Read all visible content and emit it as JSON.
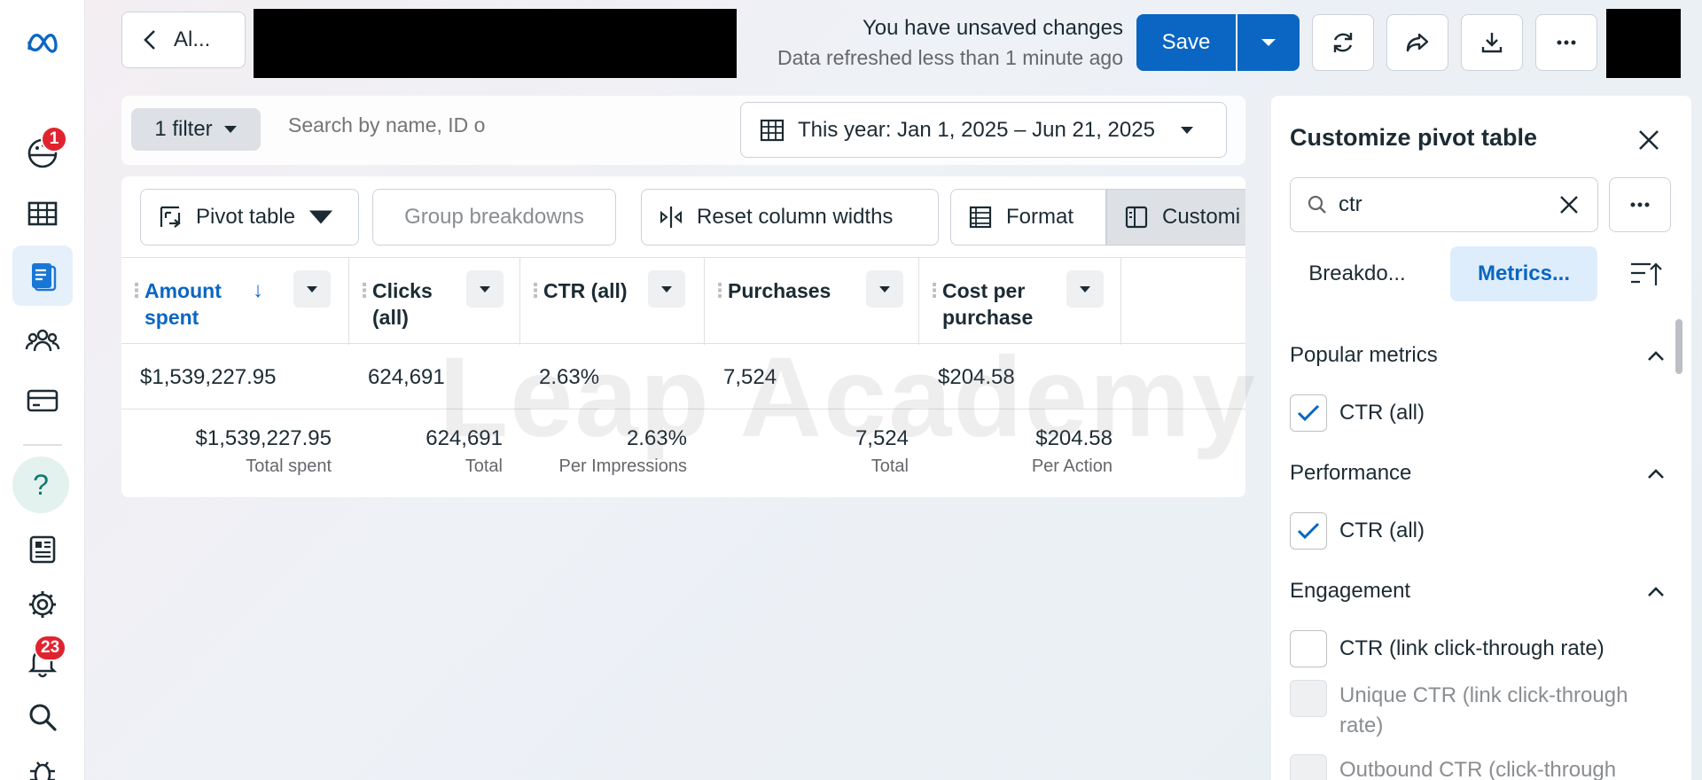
{
  "header": {
    "back_label": "Al...",
    "unsaved_text": "You have unsaved changes",
    "refreshed_text": "Data refreshed less than 1 minute ago",
    "save_label": "Save"
  },
  "rail": {
    "notification_badge_top": "1",
    "notification_badge_bell": "23",
    "help_glyph": "?"
  },
  "filter_bar": {
    "filter_label": "1 filter",
    "search_placeholder": "Search by name, ID o",
    "date_range": "This year: Jan 1, 2025 – Jun 21, 2025"
  },
  "toolbar": {
    "pivot_table": "Pivot table",
    "group_breakdowns": "Group breakdowns",
    "reset_widths": "Reset column widths",
    "format": "Format",
    "customize": "Customi"
  },
  "table": {
    "columns": [
      {
        "line1": "Amount",
        "line2": "spent"
      },
      {
        "line1": "Clicks",
        "line2": "(all)"
      },
      {
        "line1": "CTR (all)",
        "line2": ""
      },
      {
        "line1": "Purchases",
        "line2": ""
      },
      {
        "line1": "Cost per",
        "line2": "purchase"
      }
    ],
    "row": [
      "$1,539,227.95",
      "624,691",
      "2.63%",
      "7,524",
      "$204.58"
    ],
    "totals": [
      {
        "value": "$1,539,227.95",
        "label": "Total spent"
      },
      {
        "value": "624,691",
        "label": "Total"
      },
      {
        "value": "2.63%",
        "label": "Per Impressions"
      },
      {
        "value": "7,524",
        "label": "Total"
      },
      {
        "value": "$204.58",
        "label": "Per Action"
      }
    ]
  },
  "watermark": "Leap Academy",
  "panel": {
    "title": "Customize pivot table",
    "search_value": "ctr",
    "tab_breakdowns": "Breakdo...",
    "tab_metrics": "Metrics...",
    "sections": [
      {
        "title": "Popular metrics",
        "items": [
          {
            "label": "CTR (all)",
            "checked": true
          }
        ]
      },
      {
        "title": "Performance",
        "items": [
          {
            "label": "CTR (all)",
            "checked": true
          }
        ]
      },
      {
        "title": "Engagement",
        "items": [
          {
            "label": "CTR (link click-through rate)",
            "checked": false
          },
          {
            "label_line1": "Unique CTR (link click-through",
            "label_line2": "rate)",
            "checked": false,
            "disabled": true
          },
          {
            "label": "Outbound CTR (click-through",
            "checked": false,
            "disabled": true
          }
        ]
      }
    ]
  },
  "colors": {
    "accent": "#0a66c2",
    "badge": "#e0242f",
    "active_tab_bg": "#deedfb"
  }
}
